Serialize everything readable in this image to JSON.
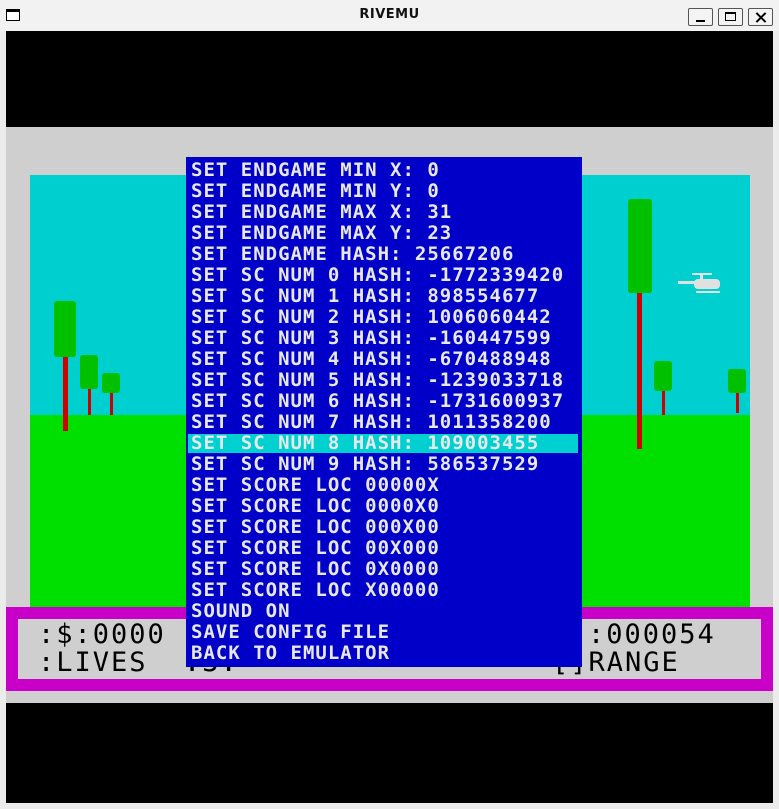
{
  "window": {
    "title": "RIVEMU"
  },
  "hud": {
    "line1": ":$:0000",
    "line1_right": ":000054",
    "line2": ":LIVES  :3:",
    "line2_right": "[]RANGE"
  },
  "menu": {
    "selected_index": 13,
    "items": [
      "SET ENDGAME MIN X: 0",
      "SET ENDGAME MIN Y: 0",
      "SET ENDGAME MAX X: 31",
      "SET ENDGAME MAX Y: 23",
      "SET ENDGAME HASH: 25667206",
      "SET SC NUM 0 HASH: -1772339420",
      "SET SC NUM 1 HASH: 898554677",
      "SET SC NUM 2 HASH: 1006060442",
      "SET SC NUM 3 HASH: -160447599",
      "SET SC NUM 4 HASH: -670488948",
      "SET SC NUM 5 HASH: -1239033718",
      "SET SC NUM 6 HASH: -1731600937",
      "SET SC NUM 7 HASH: 1011358200",
      "SET SC NUM 8 HASH: 109003455",
      "SET SC NUM 9 HASH: 586537529",
      "SET SCORE LOC 00000X",
      "SET SCORE LOC 0000X0",
      "SET SCORE LOC 000X00",
      "SET SCORE LOC 00X000",
      "SET SCORE LOC 0X0000",
      "SET SCORE LOC X00000",
      "SOUND ON",
      "SAVE CONFIG FILE",
      "BACK TO EMULATOR"
    ]
  },
  "colors": {
    "sky": "#00cfcf",
    "grass": "#00e000",
    "hud_border": "#c800c8",
    "menu_bg": "#0000c8",
    "menu_selected": "#00d0d0"
  }
}
